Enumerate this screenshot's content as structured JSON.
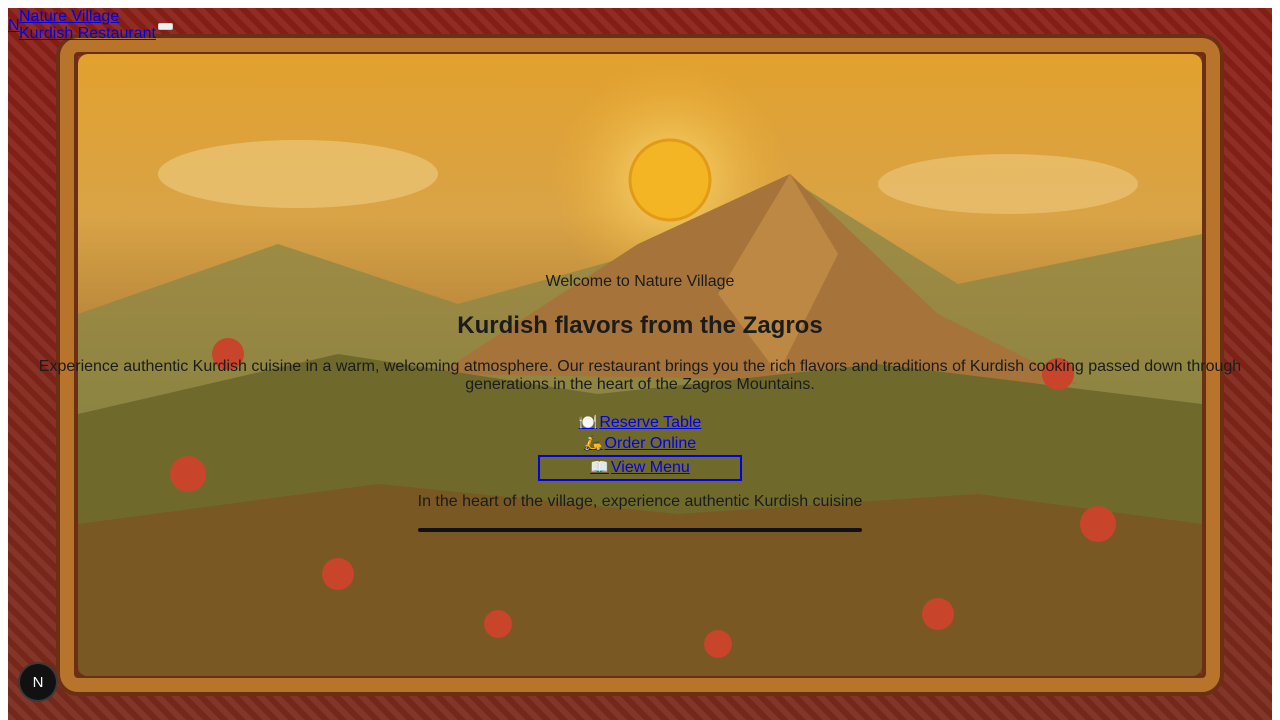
{
  "brand": {
    "logo_letter": "N",
    "line1": "Nature Village",
    "line2": "Kurdish Restaurant"
  },
  "hero": {
    "welcome": "Welcome to Nature Village",
    "headline": "Kurdish flavors from the Zagros",
    "description": "Experience authentic Kurdish cuisine in a warm, welcoming atmosphere. Our restaurant brings you the rich flavors and traditions of Kurdish cooking passed down through generations in the heart of the Zagros Mountains.",
    "tagline": "In the heart of the village, experience authentic Kurdish cuisine"
  },
  "actions": {
    "reserve": {
      "icon": "🍽️",
      "label": "Reserve Table"
    },
    "order": {
      "icon": "🛵",
      "label": "Order Online"
    },
    "menu": {
      "icon": "📖",
      "label": "View Menu"
    }
  },
  "fab": {
    "letter": "N"
  },
  "colors": {
    "link": "#0000ee",
    "text": "#1c1c1c",
    "frame": "#8a1f16",
    "sky": "#e2a12e"
  }
}
